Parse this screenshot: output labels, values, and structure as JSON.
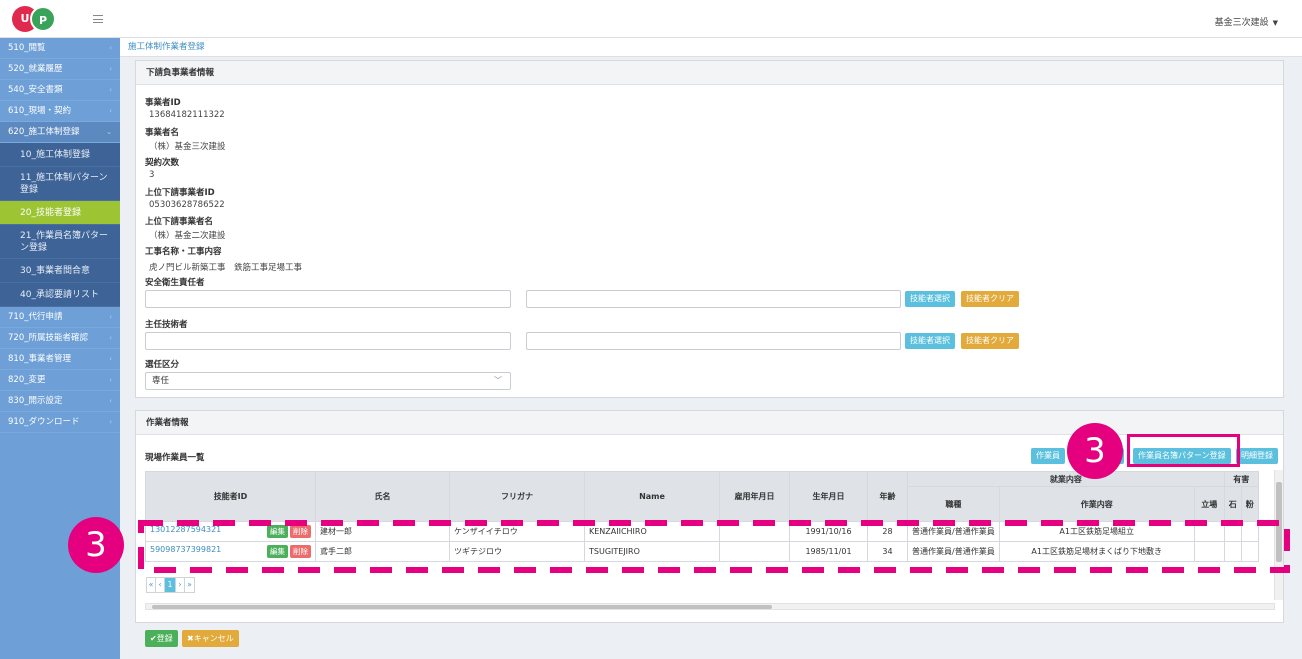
{
  "header": {
    "logo_text_1": "U",
    "logo_text_2": "P",
    "user_menu": "基金三次建設",
    "caret": "▼"
  },
  "sidebar": {
    "items": [
      {
        "label": "510_閲覧"
      },
      {
        "label": "520_就業履歴"
      },
      {
        "label": "540_安全書類"
      },
      {
        "label": "610_現場・契約"
      },
      {
        "label": "620_施工体制登録"
      }
    ],
    "sub_items": [
      {
        "label": "10_施工体制登録"
      },
      {
        "label": "11_施工体制パターン登録"
      },
      {
        "label": "20_技能者登録"
      },
      {
        "label": "21_作業員名簿パターン登録"
      },
      {
        "label": "30_事業者間合意"
      },
      {
        "label": "40_承認要請リスト"
      }
    ],
    "items_after": [
      {
        "label": "710_代行申請"
      },
      {
        "label": "720_所属技能者確認"
      },
      {
        "label": "810_事業者管理"
      },
      {
        "label": "820_変更"
      },
      {
        "label": "830_開示設定"
      },
      {
        "label": "910_ダウンロード"
      }
    ],
    "arrow": "‹"
  },
  "breadcrumb": "施工体制作業者登録",
  "sub_info": {
    "title": "下請負事業者情報",
    "biz_id_label": "事業者ID",
    "biz_id": "13684182111322",
    "biz_name_label": "事業者名",
    "biz_name": "（株）基金三次建設",
    "contract_label": "契約次数",
    "contract": "3",
    "upper_id_label": "上位下請事業者ID",
    "upper_id": "05303628786522",
    "upper_name_label": "上位下請事業者名",
    "upper_name": "（株）基金二次建設",
    "work_label": "工事名称・工事内容",
    "work": "虎ノ門ビル新築工事　鉄筋工事足場工事",
    "safety_label": "安全衛生責任者",
    "chief_label": "主任技術者",
    "select_btn": "技能者選択",
    "clear_btn": "技能者クリア",
    "assign_label": "選任区分",
    "assign_value": "専任",
    "chevron": "﹀"
  },
  "worker_info": {
    "title": "作業者情報",
    "list_title": "現場作業員一覧",
    "btn_hidden_1": "作業員",
    "btn_hidden_2": "成",
    "btn_pattern": "作業員名簿パターン登録",
    "btn_detail": "明細登録",
    "columns": [
      "技能者ID",
      "氏名",
      "フリガナ",
      "Name",
      "雇用年月日",
      "生年月日",
      "年齢"
    ],
    "group_job": "就業内容",
    "group_harm": "有害",
    "sub_columns": [
      "職種",
      "作業内容",
      "立場",
      "石",
      "粉"
    ],
    "edit_label": "編集",
    "delete_label": "削除",
    "rows": [
      {
        "id": "13012287594321",
        "name": "建材一郎",
        "kana": "ケンザイイチロウ",
        "roman": "KENZAIICHIRO",
        "hired": "",
        "birth": "1991/10/16",
        "age": "28",
        "job": "普通作業員/普通作業員",
        "task": "A1工区鉄筋足場組立"
      },
      {
        "id": "59098737399821",
        "name": "鳶手二郎",
        "kana": "ツギテジロウ",
        "roman": "TSUGITEJIRO",
        "hired": "",
        "birth": "1985/11/01",
        "age": "34",
        "job": "普通作業員/普通作業員",
        "task": "A1工区鉄筋足場材まくばり下地敷き"
      }
    ],
    "pager": [
      "«",
      "‹",
      "1",
      "›",
      "»"
    ]
  },
  "footer": {
    "register": "✔登録",
    "cancel": "✖キャンセル"
  },
  "annotations": {
    "callout_number": "3",
    "color": "#e4007f"
  }
}
